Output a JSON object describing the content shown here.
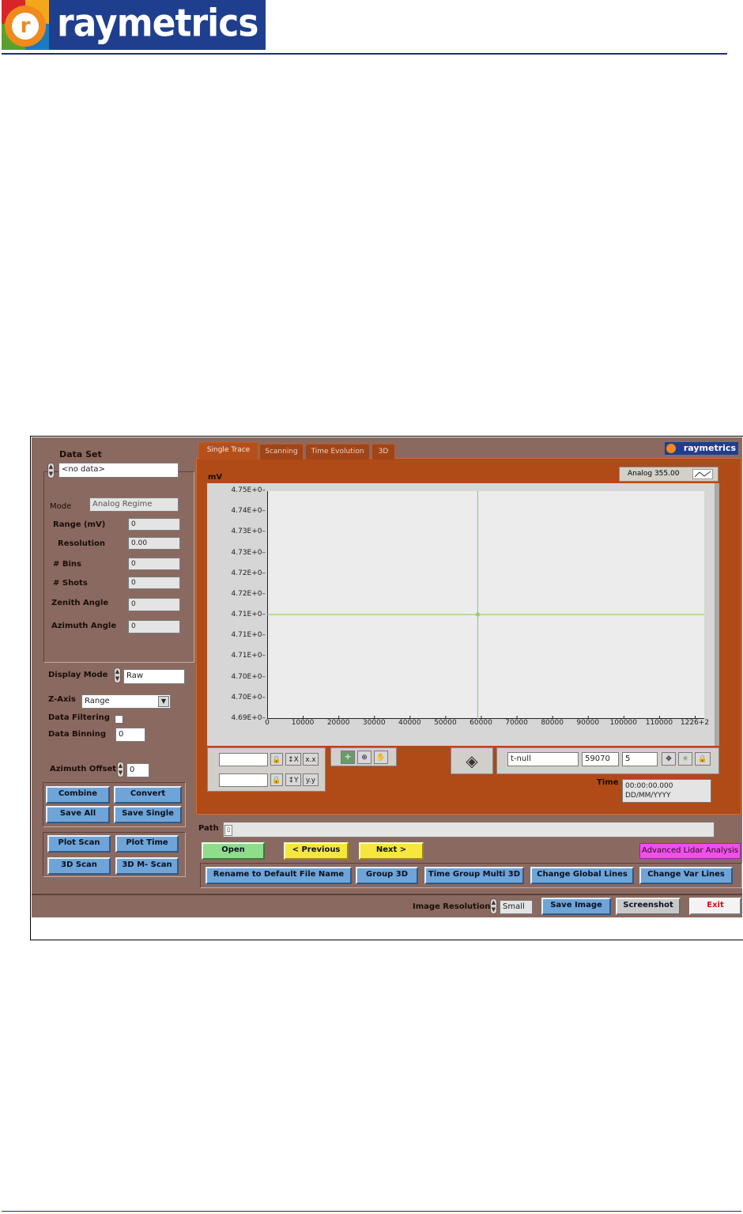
{
  "header": {
    "logo_text": "raymetrics",
    "logo_letter": "r"
  },
  "left": {
    "data_set_label": "Data Set",
    "data_set_value": "<no data>",
    "mode_label": "Mode",
    "mode_value": "Analog Regime",
    "fields": [
      {
        "label": "Range (mV)",
        "value": "0"
      },
      {
        "label": "Resolution",
        "value": "0.00"
      },
      {
        "label": "# Bins",
        "value": "0"
      },
      {
        "label": "# Shots",
        "value": "0"
      },
      {
        "label": "Zenith Angle",
        "value": "0"
      },
      {
        "label": "Azimuth Angle",
        "value": "0"
      }
    ],
    "display_mode_label": "Display Mode",
    "display_mode_value": "Raw",
    "z_axis_label": "Z-Axis",
    "z_axis_value": "Range",
    "data_filtering_label": "Data Filtering",
    "data_binning_label": "Data Binning",
    "data_binning_value": "0",
    "azimuth_offset_label": "Azimuth Offset",
    "azimuth_offset_value": "0",
    "buttons_a": [
      "Combine",
      "Convert",
      "Save All",
      "Save Single"
    ],
    "buttons_b": [
      "Plot Scan",
      "Plot Time",
      "3D Scan",
      "3D M- Scan"
    ]
  },
  "tabs": [
    "Single Trace",
    "Scanning",
    "Time Evolution",
    "3D"
  ],
  "panel_logo": "raymetrics",
  "chart_data": {
    "type": "line",
    "ylabel": "mV",
    "legend": "Analog 355.00",
    "y_ticks": [
      "4.75E+0",
      "4.74E+0",
      "4.73E+0",
      "4.73E+0",
      "4.72E+0",
      "4.72E+0",
      "4.71E+0",
      "4.71E+0",
      "4.71E+0",
      "4.70E+0",
      "4.70E+0",
      "4.69E+0"
    ],
    "x_ticks": [
      "0",
      "10000",
      "20000",
      "30000",
      "40000",
      "50000",
      "60000",
      "70000",
      "80000",
      "90000",
      "100000",
      "110000",
      "1226+2"
    ],
    "xlim": [
      0,
      122600
    ],
    "ylim": [
      4.69,
      4.75
    ],
    "cursor": {
      "x": 59070,
      "y": 4.7175
    },
    "grid": false
  },
  "cursor_panel": {
    "name": "t-null",
    "x": "59070",
    "y": "5"
  },
  "time_label": "Time",
  "time_value_1": "00:00:00.000",
  "time_value_2": "DD/MM/YYYY",
  "path_label": "Path",
  "path_value": "",
  "nav": {
    "open": "Open",
    "previous": "<  Previous",
    "next": "Next  >",
    "advanced": "Advanced Lidar Analysis"
  },
  "bottom_buttons": [
    "Rename to Default File Name",
    "Group 3D",
    "Time Group Multi 3D",
    "Change Global Lines",
    "Change Var Lines"
  ],
  "status": {
    "image_resolution_label": "Image Resolution",
    "image_resolution_value": "Small",
    "save_image": "Save Image",
    "screenshot": "Screenshot",
    "exit": "Exit"
  }
}
